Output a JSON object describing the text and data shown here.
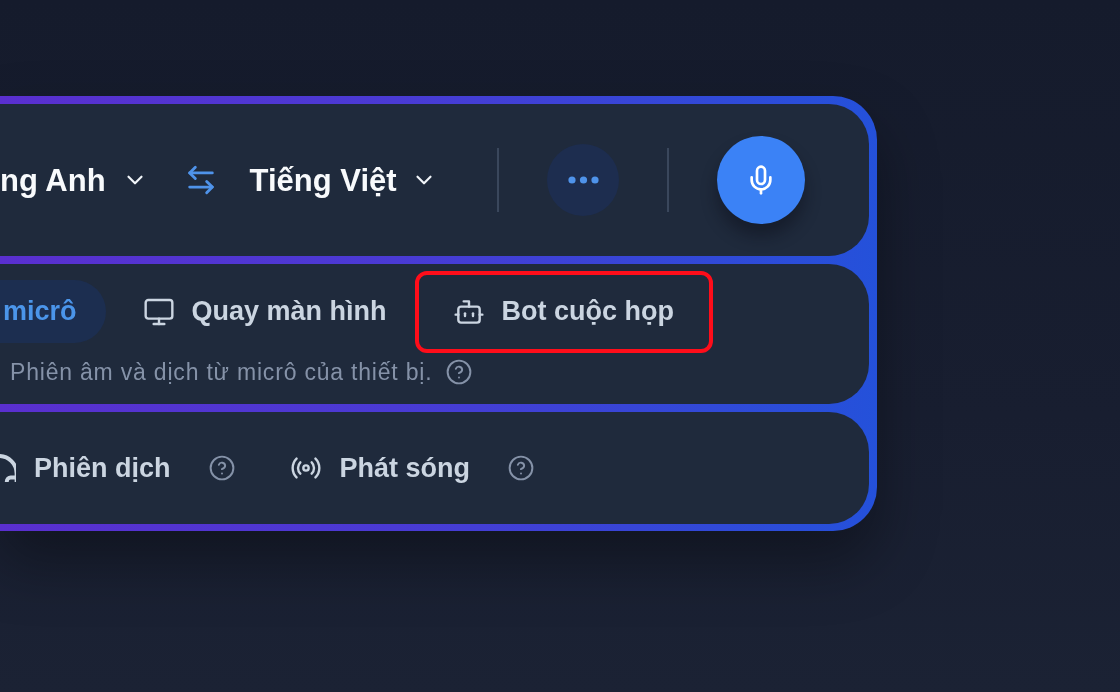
{
  "languages": {
    "source": "ng Anh",
    "target": "Tiếng Việt"
  },
  "tabs": [
    {
      "label": "micrô",
      "selected": true,
      "highlighted": false
    },
    {
      "label": "Quay màn hình",
      "selected": false,
      "highlighted": false
    },
    {
      "label": "Bot cuộc họp",
      "selected": false,
      "highlighted": true
    }
  ],
  "description": "Phiên âm và dịch từ micrô của thiết bị.",
  "modes": [
    {
      "label": "Phiên dịch"
    },
    {
      "label": "Phát sóng"
    }
  ]
}
